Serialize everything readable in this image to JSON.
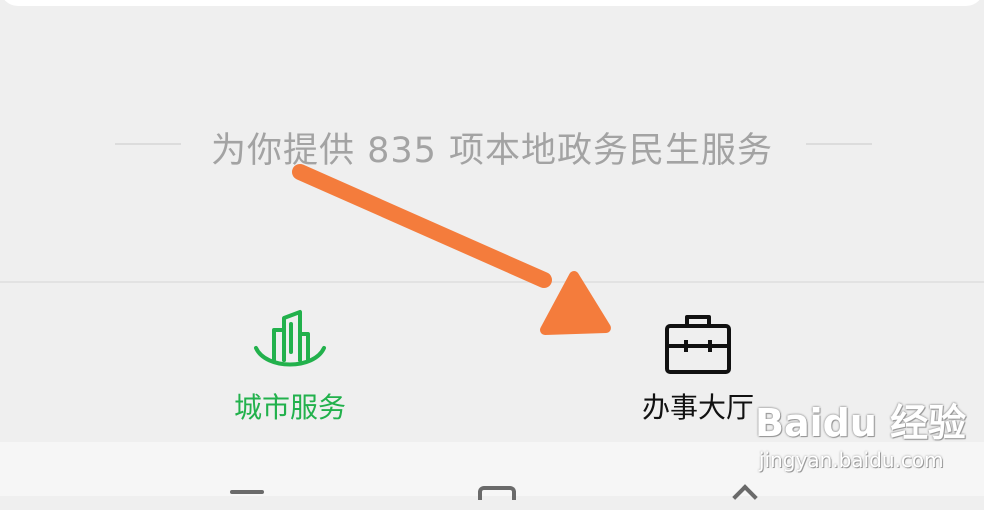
{
  "summary": {
    "text": "为你提供 835 项本地政务民生服务"
  },
  "tabs": [
    {
      "label": "城市服务",
      "icon": "city-buildings-icon",
      "active": true
    },
    {
      "label": "办事大厅",
      "icon": "briefcase-icon",
      "active": false
    }
  ],
  "annotation": {
    "icon": "orange-arrow-icon"
  },
  "watermark": {
    "brand": "Baidu 经验",
    "url": "jingyan.baidu.com"
  },
  "colors": {
    "active": "#22b14c",
    "arrow": "#f47c3c",
    "muted_text": "#a3a3a3"
  }
}
